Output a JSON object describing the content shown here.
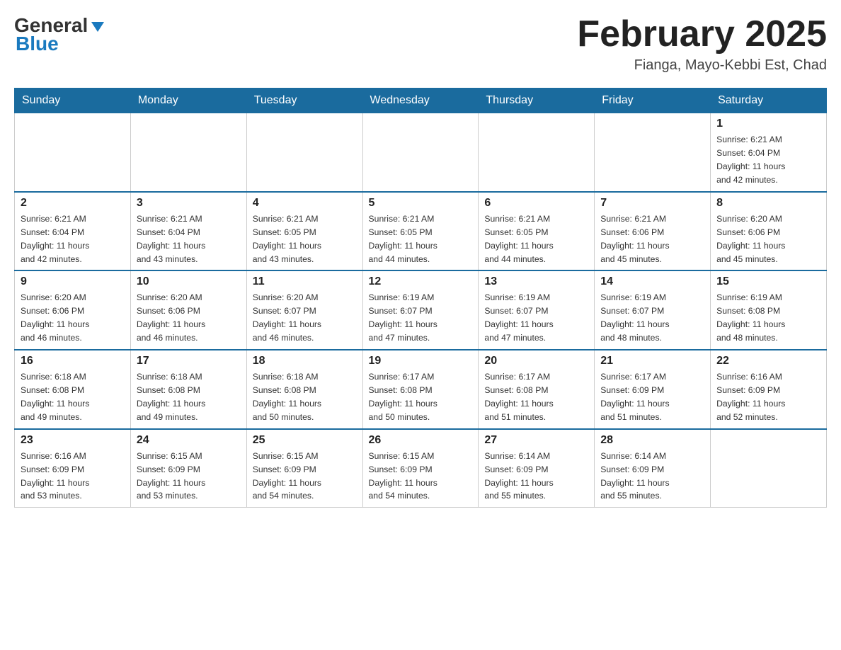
{
  "logo": {
    "general": "General",
    "blue": "Blue"
  },
  "title": {
    "month": "February 2025",
    "location": "Fianga, Mayo-Kebbi Est, Chad"
  },
  "days_of_week": [
    "Sunday",
    "Monday",
    "Tuesday",
    "Wednesday",
    "Thursday",
    "Friday",
    "Saturday"
  ],
  "weeks": [
    [
      {
        "day": "",
        "info": ""
      },
      {
        "day": "",
        "info": ""
      },
      {
        "day": "",
        "info": ""
      },
      {
        "day": "",
        "info": ""
      },
      {
        "day": "",
        "info": ""
      },
      {
        "day": "",
        "info": ""
      },
      {
        "day": "1",
        "info": "Sunrise: 6:21 AM\nSunset: 6:04 PM\nDaylight: 11 hours\nand 42 minutes."
      }
    ],
    [
      {
        "day": "2",
        "info": "Sunrise: 6:21 AM\nSunset: 6:04 PM\nDaylight: 11 hours\nand 42 minutes."
      },
      {
        "day": "3",
        "info": "Sunrise: 6:21 AM\nSunset: 6:04 PM\nDaylight: 11 hours\nand 43 minutes."
      },
      {
        "day": "4",
        "info": "Sunrise: 6:21 AM\nSunset: 6:05 PM\nDaylight: 11 hours\nand 43 minutes."
      },
      {
        "day": "5",
        "info": "Sunrise: 6:21 AM\nSunset: 6:05 PM\nDaylight: 11 hours\nand 44 minutes."
      },
      {
        "day": "6",
        "info": "Sunrise: 6:21 AM\nSunset: 6:05 PM\nDaylight: 11 hours\nand 44 minutes."
      },
      {
        "day": "7",
        "info": "Sunrise: 6:21 AM\nSunset: 6:06 PM\nDaylight: 11 hours\nand 45 minutes."
      },
      {
        "day": "8",
        "info": "Sunrise: 6:20 AM\nSunset: 6:06 PM\nDaylight: 11 hours\nand 45 minutes."
      }
    ],
    [
      {
        "day": "9",
        "info": "Sunrise: 6:20 AM\nSunset: 6:06 PM\nDaylight: 11 hours\nand 46 minutes."
      },
      {
        "day": "10",
        "info": "Sunrise: 6:20 AM\nSunset: 6:06 PM\nDaylight: 11 hours\nand 46 minutes."
      },
      {
        "day": "11",
        "info": "Sunrise: 6:20 AM\nSunset: 6:07 PM\nDaylight: 11 hours\nand 46 minutes."
      },
      {
        "day": "12",
        "info": "Sunrise: 6:19 AM\nSunset: 6:07 PM\nDaylight: 11 hours\nand 47 minutes."
      },
      {
        "day": "13",
        "info": "Sunrise: 6:19 AM\nSunset: 6:07 PM\nDaylight: 11 hours\nand 47 minutes."
      },
      {
        "day": "14",
        "info": "Sunrise: 6:19 AM\nSunset: 6:07 PM\nDaylight: 11 hours\nand 48 minutes."
      },
      {
        "day": "15",
        "info": "Sunrise: 6:19 AM\nSunset: 6:08 PM\nDaylight: 11 hours\nand 48 minutes."
      }
    ],
    [
      {
        "day": "16",
        "info": "Sunrise: 6:18 AM\nSunset: 6:08 PM\nDaylight: 11 hours\nand 49 minutes."
      },
      {
        "day": "17",
        "info": "Sunrise: 6:18 AM\nSunset: 6:08 PM\nDaylight: 11 hours\nand 49 minutes."
      },
      {
        "day": "18",
        "info": "Sunrise: 6:18 AM\nSunset: 6:08 PM\nDaylight: 11 hours\nand 50 minutes."
      },
      {
        "day": "19",
        "info": "Sunrise: 6:17 AM\nSunset: 6:08 PM\nDaylight: 11 hours\nand 50 minutes."
      },
      {
        "day": "20",
        "info": "Sunrise: 6:17 AM\nSunset: 6:08 PM\nDaylight: 11 hours\nand 51 minutes."
      },
      {
        "day": "21",
        "info": "Sunrise: 6:17 AM\nSunset: 6:09 PM\nDaylight: 11 hours\nand 51 minutes."
      },
      {
        "day": "22",
        "info": "Sunrise: 6:16 AM\nSunset: 6:09 PM\nDaylight: 11 hours\nand 52 minutes."
      }
    ],
    [
      {
        "day": "23",
        "info": "Sunrise: 6:16 AM\nSunset: 6:09 PM\nDaylight: 11 hours\nand 53 minutes."
      },
      {
        "day": "24",
        "info": "Sunrise: 6:15 AM\nSunset: 6:09 PM\nDaylight: 11 hours\nand 53 minutes."
      },
      {
        "day": "25",
        "info": "Sunrise: 6:15 AM\nSunset: 6:09 PM\nDaylight: 11 hours\nand 54 minutes."
      },
      {
        "day": "26",
        "info": "Sunrise: 6:15 AM\nSunset: 6:09 PM\nDaylight: 11 hours\nand 54 minutes."
      },
      {
        "day": "27",
        "info": "Sunrise: 6:14 AM\nSunset: 6:09 PM\nDaylight: 11 hours\nand 55 minutes."
      },
      {
        "day": "28",
        "info": "Sunrise: 6:14 AM\nSunset: 6:09 PM\nDaylight: 11 hours\nand 55 minutes."
      },
      {
        "day": "",
        "info": ""
      }
    ]
  ],
  "colors": {
    "header_bg": "#1a6b9e",
    "header_text": "#ffffff",
    "border": "#1a6b9e"
  }
}
